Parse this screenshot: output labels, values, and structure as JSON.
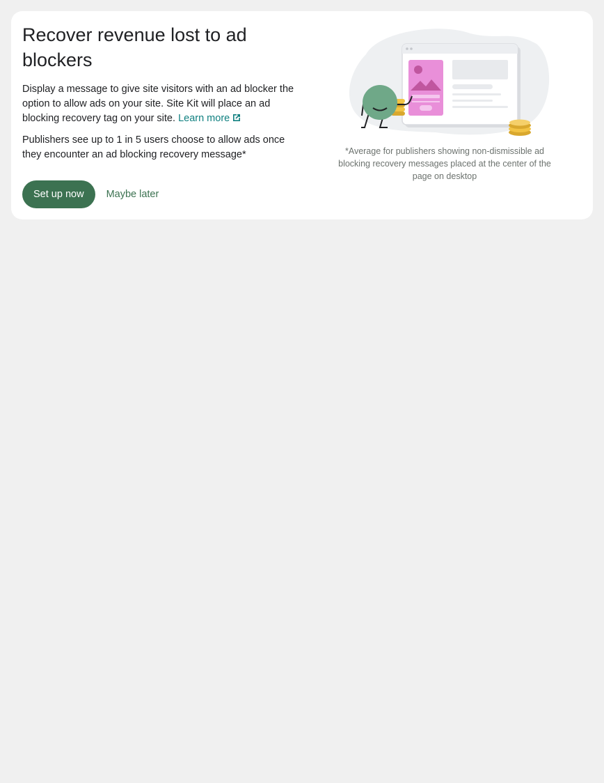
{
  "card": {
    "title": "Recover revenue lost to ad blockers",
    "description": "Display a message to give site visitors with an ad blocker the option to allow ads on your site. Site Kit will place an ad blocking recovery tag on your site.",
    "learn_more_label": "Learn more",
    "stat_text": "Publishers see up to 1 in 5 users choose to allow ads once they encounter an ad blocking recovery message*",
    "footnote": "*Average for publishers showing non-dismissible ad blocking recovery messages placed at the center of the page on desktop"
  },
  "actions": {
    "primary_label": "Set up now",
    "secondary_label": "Maybe later"
  },
  "icons": {
    "learn_more": "external-link-icon",
    "illustration": "ad-blocking-recovery-illustration"
  },
  "colors": {
    "page_background": "#f0f0f0",
    "card_background": "#ffffff",
    "primary_button": "#3c7251",
    "link": "#108080",
    "footnote_text": "#6c726e",
    "character": "#6fa888",
    "ad_pink": "#e98fd9",
    "coins": "#f2c344"
  }
}
